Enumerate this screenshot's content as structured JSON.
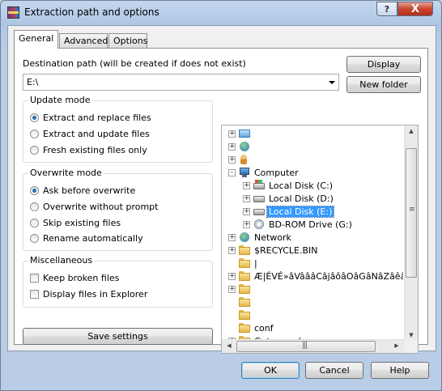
{
  "window": {
    "title": "Extraction path and options",
    "help_button": "?",
    "close_button": "X"
  },
  "tabs": [
    {
      "label": "General",
      "active": true
    },
    {
      "label": "Advanced",
      "active": false
    },
    {
      "label": "Options",
      "active": false
    }
  ],
  "destination": {
    "label": "Destination path (will be created if does not exist)",
    "value": "E:\\",
    "display_button": "Display",
    "new_folder_button": "New folder"
  },
  "update_mode": {
    "title": "Update mode",
    "options": [
      "Extract and replace files",
      "Extract and update files",
      "Fresh existing files only"
    ],
    "selected": 0
  },
  "overwrite_mode": {
    "title": "Overwrite mode",
    "options": [
      "Ask before overwrite",
      "Overwrite without prompt",
      "Skip existing files",
      "Rename automatically"
    ],
    "selected": 0
  },
  "misc": {
    "title": "Miscellaneous",
    "options": [
      "Keep broken files",
      "Display files in Explorer"
    ],
    "checked": [
      false,
      false
    ]
  },
  "save_button": "Save settings",
  "tree": {
    "nodes": [
      {
        "label": "",
        "icon": "blue-folder-icon",
        "depth": 0,
        "expander": "+"
      },
      {
        "label": "",
        "icon": "network-icon",
        "depth": 0,
        "expander": "+"
      },
      {
        "label": "",
        "icon": "user-icon",
        "depth": 0,
        "expander": "+"
      },
      {
        "label": "Computer",
        "icon": "computer-icon",
        "depth": 0,
        "expander": "-"
      },
      {
        "label": "Local Disk (C:)",
        "icon": "windows-drive-icon",
        "depth": 1,
        "expander": "+"
      },
      {
        "label": "Local Disk (D:)",
        "icon": "drive-icon",
        "depth": 1,
        "expander": "+"
      },
      {
        "label": "Local Disk (E:)",
        "icon": "drive-icon",
        "depth": 1,
        "expander": "+",
        "selected": true
      },
      {
        "label": "BD-ROM Drive (G:)",
        "icon": "cd-drive-icon",
        "depth": 1,
        "expander": "+"
      },
      {
        "label": "Network",
        "icon": "network-icon",
        "depth": 0,
        "expander": "+"
      },
      {
        "label": "$RECYCLE.BIN",
        "icon": "folder-icon",
        "depth": 0,
        "expander": "+"
      },
      {
        "label": "|",
        "icon": "folder-icon",
        "depth": 0,
        "expander": ""
      },
      {
        "label": "Æ|ÉVÉ»âVâââCâjâôâOâGâNâZâêâÎâô",
        "icon": "folder-icon",
        "depth": 0,
        "expander": "+"
      },
      {
        "label": "",
        "icon": "folder-icon",
        "depth": 0,
        "expander": "+"
      },
      {
        "label": "",
        "icon": "folder-icon",
        "depth": 0,
        "expander": ""
      },
      {
        "label": "",
        "icon": "folder-icon",
        "depth": 0,
        "expander": ""
      },
      {
        "label": "conf",
        "icon": "folder-icon",
        "depth": 0,
        "expander": ""
      },
      {
        "label": "Getamped",
        "icon": "folder-icon",
        "depth": 0,
        "expander": "+"
      }
    ]
  },
  "footer": {
    "ok": "OK",
    "cancel": "Cancel",
    "help": "Help"
  }
}
